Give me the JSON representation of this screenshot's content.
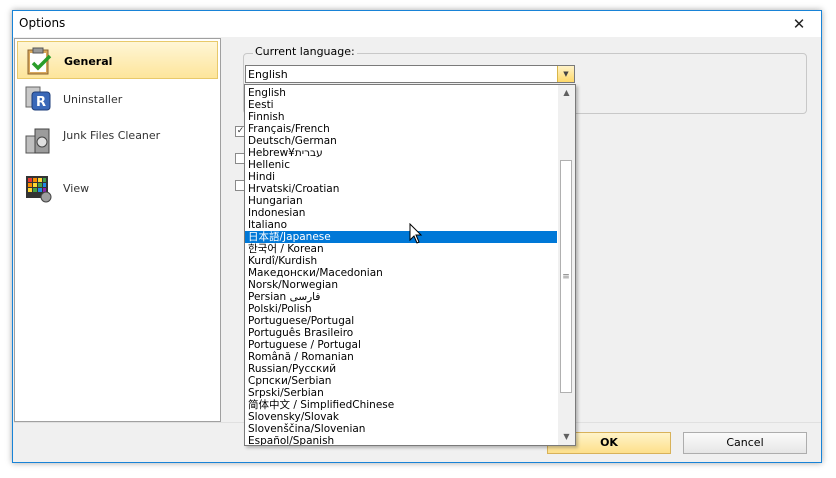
{
  "window": {
    "title": "Options"
  },
  "sidebar": {
    "items": [
      {
        "label": "General",
        "icon": "clipboard-check-icon",
        "selected": true
      },
      {
        "label": "Uninstaller",
        "icon": "uninstaller-icon"
      },
      {
        "label": "Junk Files Cleaner",
        "icon": "junk-files-icon"
      },
      {
        "label": "View",
        "icon": "view-palette-icon"
      }
    ]
  },
  "language": {
    "group_label": "Current language:",
    "current": "English",
    "selected_index": 12,
    "options": [
      "English",
      "Eesti",
      "Finnish",
      "Français/French",
      "Deutsch/German",
      "Hebrew¥עברית",
      "Hellenic",
      "Hindi",
      "Hrvatski/Croatian",
      "Hungarian",
      "Indonesian",
      "Italiano",
      "日本語/Japanese",
      "한국어 / Korean",
      "Kurdî/Kurdish",
      "Македонски/Macedonian",
      "Norsk/Norwegian",
      "Persian فارسی",
      "Polski/Polish",
      "Portuguese/Portugal",
      "Português Brasileiro",
      "Portuguese / Portugal",
      "Română / Romanian",
      "Russian/Русский",
      "Српски/Serbian",
      "Srpski/Serbian",
      "简体中文 / SimplifiedChinese",
      "Slovensky/Slovak",
      "Slovenščina/Slovenian",
      "Español/Spanish"
    ]
  },
  "checkboxes": [
    {
      "checked": true
    },
    {
      "checked": false
    },
    {
      "checked": false
    }
  ],
  "buttons": {
    "ok": "OK",
    "cancel": "Cancel"
  },
  "colors": {
    "accent": "#0078d7",
    "selected_nav": "#fde59b",
    "window_border": "#1883d7"
  }
}
